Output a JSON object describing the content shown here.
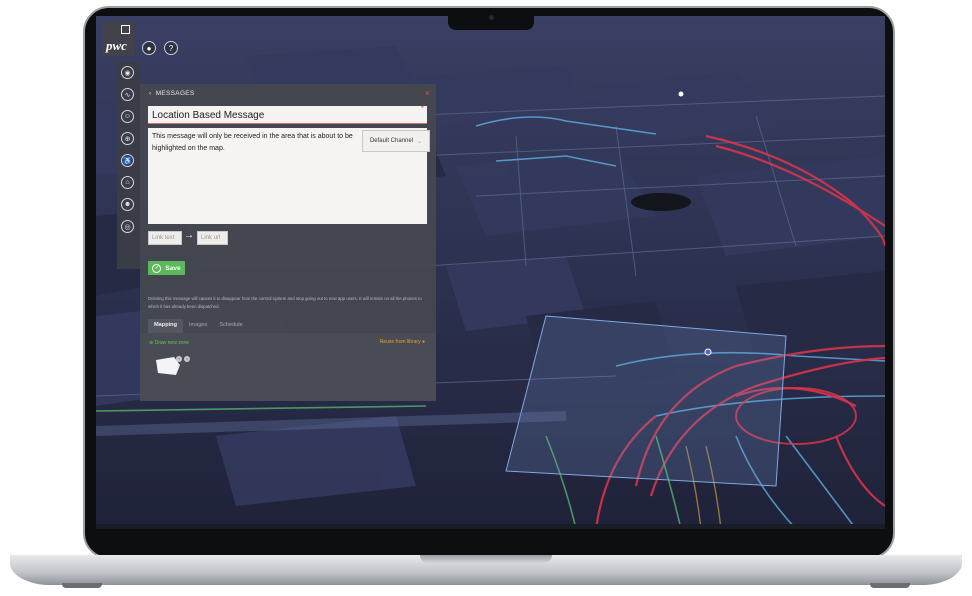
{
  "app": {
    "logo_text": "pwc"
  },
  "panel": {
    "header": "MESSAGES",
    "back_icon": "chevron-left-icon",
    "title_value": "Location Based Message",
    "message_value": "This message will only be received in the area that is about to be highlighted on the map.",
    "channel_value": "Default Channel",
    "link_text_placeholder": "Link text",
    "link_url_placeholder": "Link url",
    "save_label": "Save",
    "warning_text": "Deleting this message will causes it to disappear from the control system and stop going out to new app users. It will remain on all the phones to which it has already been dispatched.",
    "tabs": [
      {
        "label": "Mapping",
        "active": true
      },
      {
        "label": "Images",
        "active": false
      },
      {
        "label": "Schedule",
        "active": false
      }
    ],
    "draw_zone_label": "Draw new zone",
    "reuse_label": "Reuse from library"
  },
  "colors": {
    "accent_green": "#5cb85c",
    "accent_orange": "#e8a030",
    "required_red": "#e34b4b",
    "map_route_red": "#d8344a",
    "map_route_blue": "#5aa8d8"
  },
  "icons": {
    "top": [
      "lightbulb-icon",
      "help-icon"
    ],
    "sidebar": [
      "eye-icon",
      "chart-icon",
      "users-icon",
      "target-icon",
      "accessibility-icon",
      "pin-icon",
      "user-icon",
      "globe-icon"
    ]
  }
}
